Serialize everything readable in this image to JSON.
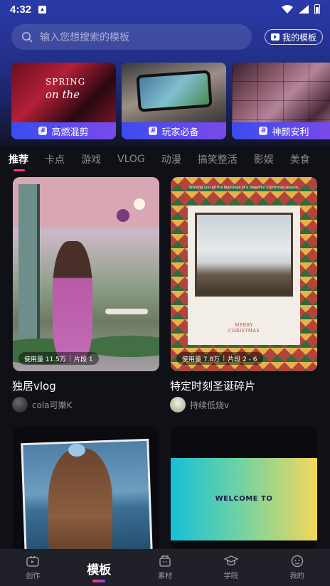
{
  "status_bar": {
    "time": "4:32"
  },
  "search": {
    "placeholder": "输入您想搜索的模板",
    "my_template_label": "我的模板"
  },
  "banners": [
    {
      "label": "高燃混剪",
      "art_text_1": "SPRING",
      "art_text_2": "on the"
    },
    {
      "label": "玩家必备"
    },
    {
      "label": "神颜安利"
    }
  ],
  "tabs": [
    "推荐",
    "卡点",
    "游戏",
    "VLOG",
    "动漫",
    "搞笑整活",
    "影娱",
    "美食"
  ],
  "active_tab": "推荐",
  "cards": [
    {
      "title": "独居vlog",
      "author": "cola可樂K",
      "usage": "使用量 11.5万",
      "segments": "片段 1"
    },
    {
      "title": "特定时刻圣诞碎片",
      "author": "持续低烧v",
      "usage": "使用量 7.8万",
      "segments": "片段 2 - 6",
      "art_wish": "Wishing you all the blessings of a beautiful Christmas season.",
      "art_merry": "MERRY",
      "art_christmas": "CHRISTMAS"
    },
    {
      "title": ""
    },
    {
      "title": "",
      "art_welcome": "WELCOME TO"
    }
  ],
  "bottom_nav": [
    {
      "label": "创作",
      "icon": "create-icon"
    },
    {
      "label": "模板",
      "icon": "template-icon"
    },
    {
      "label": "素材",
      "icon": "material-icon"
    },
    {
      "label": "学院",
      "icon": "academy-icon"
    },
    {
      "label": "我的",
      "icon": "profile-icon"
    }
  ],
  "active_nav": "模板",
  "colors": {
    "accent": "#ff3d6a",
    "banner_label_start": "#3a4cf0",
    "banner_label_end": "#7b4ae8",
    "header_top": "#2a3aa8"
  }
}
